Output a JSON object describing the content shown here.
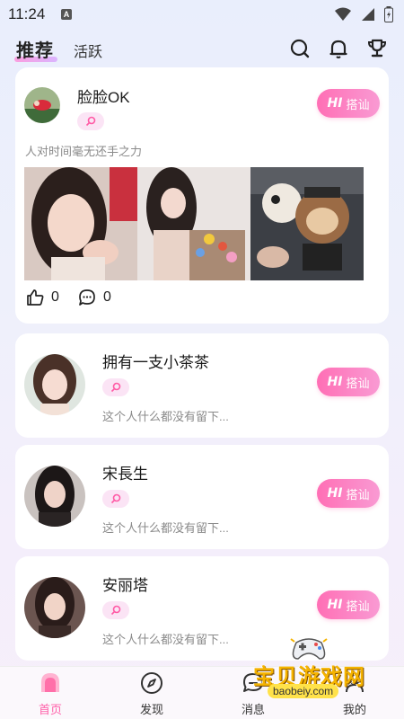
{
  "status_bar": {
    "time": "11:24",
    "notification_letter": "A"
  },
  "header": {
    "tabs": [
      {
        "label": "推荐",
        "active": true
      },
      {
        "label": "活跃",
        "active": false
      }
    ],
    "icons": [
      "search-icon",
      "bell-icon",
      "trophy-icon"
    ]
  },
  "featured_post": {
    "name": "脸脸OK",
    "motto": "人对时间毫无还手之力",
    "hi_mark": "HI",
    "hi_label": "搭讪",
    "likes": "0",
    "comments": "0"
  },
  "users": [
    {
      "name": "拥有一支小茶茶",
      "motto": "这个人什么都没有留下...",
      "hi_mark": "HI",
      "hi_label": "搭讪"
    },
    {
      "name": "宋長生",
      "motto": "这个人什么都没有留下...",
      "hi_mark": "HI",
      "hi_label": "搭讪"
    },
    {
      "name": "安丽塔",
      "motto": "这个人什么都没有留下...",
      "hi_mark": "HI",
      "hi_label": "搭讪"
    }
  ],
  "bottom_nav": [
    {
      "label": "首页",
      "icon": "home-icon",
      "active": true
    },
    {
      "label": "发现",
      "icon": "compass-icon",
      "active": false
    },
    {
      "label": "消息",
      "icon": "message-icon",
      "active": false
    },
    {
      "label": "我的",
      "icon": "profile-icon",
      "active": false
    }
  ],
  "watermark": {
    "text": "宝贝游戏网",
    "url": "baobeiy.com"
  },
  "colors": {
    "accent": "#ff6fb5",
    "tag_bg": "#fbe4f5",
    "background": "#eef0fb"
  }
}
